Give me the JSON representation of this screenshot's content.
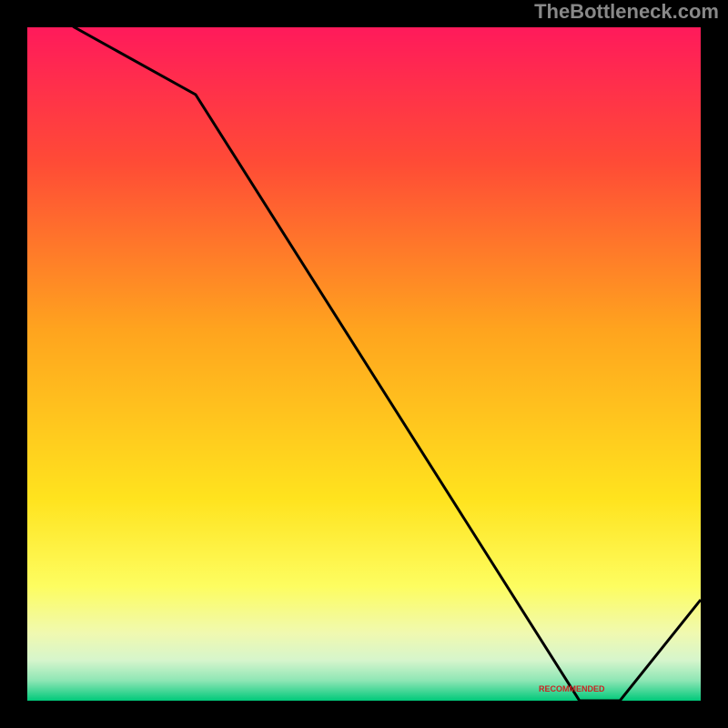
{
  "attribution": "TheBottleneck.com",
  "bottom_label": "RECOMMENDED",
  "chart_data": {
    "type": "line",
    "title": "",
    "xlabel": "",
    "ylabel": "",
    "xlim": [
      0,
      100
    ],
    "ylim": [
      0,
      100
    ],
    "x": [
      0,
      7,
      25,
      82,
      88,
      100
    ],
    "values": [
      105,
      100,
      90,
      0,
      0,
      15
    ],
    "gradient_stops": [
      {
        "pct": 0,
        "color": "#ff1a5b"
      },
      {
        "pct": 20,
        "color": "#ff4b36"
      },
      {
        "pct": 45,
        "color": "#ffa41e"
      },
      {
        "pct": 70,
        "color": "#ffe31e"
      },
      {
        "pct": 83,
        "color": "#fdfd60"
      },
      {
        "pct": 90,
        "color": "#f0f9b0"
      },
      {
        "pct": 94,
        "color": "#d6f5cc"
      },
      {
        "pct": 97,
        "color": "#8ee6b5"
      },
      {
        "pct": 100,
        "color": "#00c97a"
      }
    ],
    "recommended_range_x": [
      72,
      88
    ]
  }
}
